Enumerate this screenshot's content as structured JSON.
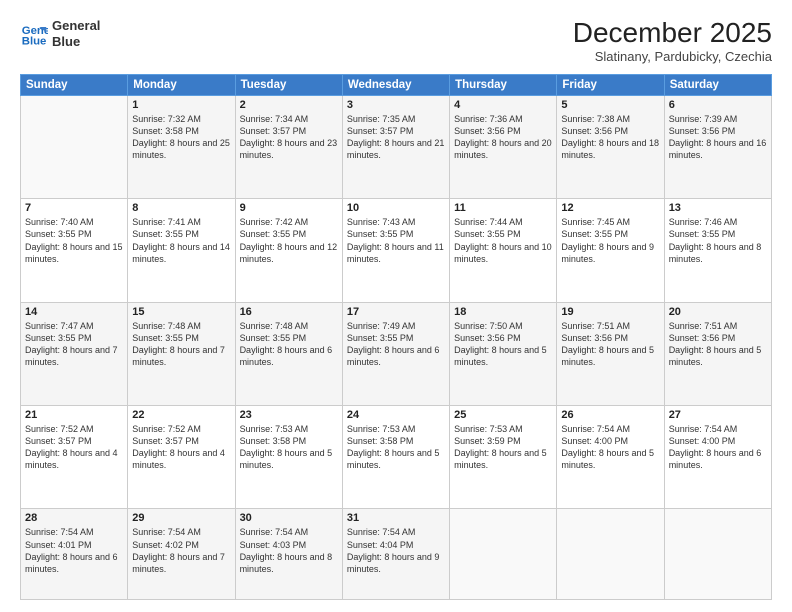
{
  "header": {
    "logo_line1": "General",
    "logo_line2": "Blue",
    "month": "December 2025",
    "location": "Slatinany, Pardubicky, Czechia"
  },
  "days_of_week": [
    "Sunday",
    "Monday",
    "Tuesday",
    "Wednesday",
    "Thursday",
    "Friday",
    "Saturday"
  ],
  "weeks": [
    [
      {
        "day": "",
        "sunrise": "",
        "sunset": "",
        "daylight": ""
      },
      {
        "day": "1",
        "sunrise": "Sunrise: 7:32 AM",
        "sunset": "Sunset: 3:58 PM",
        "daylight": "Daylight: 8 hours and 25 minutes."
      },
      {
        "day": "2",
        "sunrise": "Sunrise: 7:34 AM",
        "sunset": "Sunset: 3:57 PM",
        "daylight": "Daylight: 8 hours and 23 minutes."
      },
      {
        "day": "3",
        "sunrise": "Sunrise: 7:35 AM",
        "sunset": "Sunset: 3:57 PM",
        "daylight": "Daylight: 8 hours and 21 minutes."
      },
      {
        "day": "4",
        "sunrise": "Sunrise: 7:36 AM",
        "sunset": "Sunset: 3:56 PM",
        "daylight": "Daylight: 8 hours and 20 minutes."
      },
      {
        "day": "5",
        "sunrise": "Sunrise: 7:38 AM",
        "sunset": "Sunset: 3:56 PM",
        "daylight": "Daylight: 8 hours and 18 minutes."
      },
      {
        "day": "6",
        "sunrise": "Sunrise: 7:39 AM",
        "sunset": "Sunset: 3:56 PM",
        "daylight": "Daylight: 8 hours and 16 minutes."
      }
    ],
    [
      {
        "day": "7",
        "sunrise": "Sunrise: 7:40 AM",
        "sunset": "Sunset: 3:55 PM",
        "daylight": "Daylight: 8 hours and 15 minutes."
      },
      {
        "day": "8",
        "sunrise": "Sunrise: 7:41 AM",
        "sunset": "Sunset: 3:55 PM",
        "daylight": "Daylight: 8 hours and 14 minutes."
      },
      {
        "day": "9",
        "sunrise": "Sunrise: 7:42 AM",
        "sunset": "Sunset: 3:55 PM",
        "daylight": "Daylight: 8 hours and 12 minutes."
      },
      {
        "day": "10",
        "sunrise": "Sunrise: 7:43 AM",
        "sunset": "Sunset: 3:55 PM",
        "daylight": "Daylight: 8 hours and 11 minutes."
      },
      {
        "day": "11",
        "sunrise": "Sunrise: 7:44 AM",
        "sunset": "Sunset: 3:55 PM",
        "daylight": "Daylight: 8 hours and 10 minutes."
      },
      {
        "day": "12",
        "sunrise": "Sunrise: 7:45 AM",
        "sunset": "Sunset: 3:55 PM",
        "daylight": "Daylight: 8 hours and 9 minutes."
      },
      {
        "day": "13",
        "sunrise": "Sunrise: 7:46 AM",
        "sunset": "Sunset: 3:55 PM",
        "daylight": "Daylight: 8 hours and 8 minutes."
      }
    ],
    [
      {
        "day": "14",
        "sunrise": "Sunrise: 7:47 AM",
        "sunset": "Sunset: 3:55 PM",
        "daylight": "Daylight: 8 hours and 7 minutes."
      },
      {
        "day": "15",
        "sunrise": "Sunrise: 7:48 AM",
        "sunset": "Sunset: 3:55 PM",
        "daylight": "Daylight: 8 hours and 7 minutes."
      },
      {
        "day": "16",
        "sunrise": "Sunrise: 7:48 AM",
        "sunset": "Sunset: 3:55 PM",
        "daylight": "Daylight: 8 hours and 6 minutes."
      },
      {
        "day": "17",
        "sunrise": "Sunrise: 7:49 AM",
        "sunset": "Sunset: 3:55 PM",
        "daylight": "Daylight: 8 hours and 6 minutes."
      },
      {
        "day": "18",
        "sunrise": "Sunrise: 7:50 AM",
        "sunset": "Sunset: 3:56 PM",
        "daylight": "Daylight: 8 hours and 5 minutes."
      },
      {
        "day": "19",
        "sunrise": "Sunrise: 7:51 AM",
        "sunset": "Sunset: 3:56 PM",
        "daylight": "Daylight: 8 hours and 5 minutes."
      },
      {
        "day": "20",
        "sunrise": "Sunrise: 7:51 AM",
        "sunset": "Sunset: 3:56 PM",
        "daylight": "Daylight: 8 hours and 5 minutes."
      }
    ],
    [
      {
        "day": "21",
        "sunrise": "Sunrise: 7:52 AM",
        "sunset": "Sunset: 3:57 PM",
        "daylight": "Daylight: 8 hours and 4 minutes."
      },
      {
        "day": "22",
        "sunrise": "Sunrise: 7:52 AM",
        "sunset": "Sunset: 3:57 PM",
        "daylight": "Daylight: 8 hours and 4 minutes."
      },
      {
        "day": "23",
        "sunrise": "Sunrise: 7:53 AM",
        "sunset": "Sunset: 3:58 PM",
        "daylight": "Daylight: 8 hours and 5 minutes."
      },
      {
        "day": "24",
        "sunrise": "Sunrise: 7:53 AM",
        "sunset": "Sunset: 3:58 PM",
        "daylight": "Daylight: 8 hours and 5 minutes."
      },
      {
        "day": "25",
        "sunrise": "Sunrise: 7:53 AM",
        "sunset": "Sunset: 3:59 PM",
        "daylight": "Daylight: 8 hours and 5 minutes."
      },
      {
        "day": "26",
        "sunrise": "Sunrise: 7:54 AM",
        "sunset": "Sunset: 4:00 PM",
        "daylight": "Daylight: 8 hours and 5 minutes."
      },
      {
        "day": "27",
        "sunrise": "Sunrise: 7:54 AM",
        "sunset": "Sunset: 4:00 PM",
        "daylight": "Daylight: 8 hours and 6 minutes."
      }
    ],
    [
      {
        "day": "28",
        "sunrise": "Sunrise: 7:54 AM",
        "sunset": "Sunset: 4:01 PM",
        "daylight": "Daylight: 8 hours and 6 minutes."
      },
      {
        "day": "29",
        "sunrise": "Sunrise: 7:54 AM",
        "sunset": "Sunset: 4:02 PM",
        "daylight": "Daylight: 8 hours and 7 minutes."
      },
      {
        "day": "30",
        "sunrise": "Sunrise: 7:54 AM",
        "sunset": "Sunset: 4:03 PM",
        "daylight": "Daylight: 8 hours and 8 minutes."
      },
      {
        "day": "31",
        "sunrise": "Sunrise: 7:54 AM",
        "sunset": "Sunset: 4:04 PM",
        "daylight": "Daylight: 8 hours and 9 minutes."
      },
      {
        "day": "",
        "sunrise": "",
        "sunset": "",
        "daylight": ""
      },
      {
        "day": "",
        "sunrise": "",
        "sunset": "",
        "daylight": ""
      },
      {
        "day": "",
        "sunrise": "",
        "sunset": "",
        "daylight": ""
      }
    ]
  ]
}
